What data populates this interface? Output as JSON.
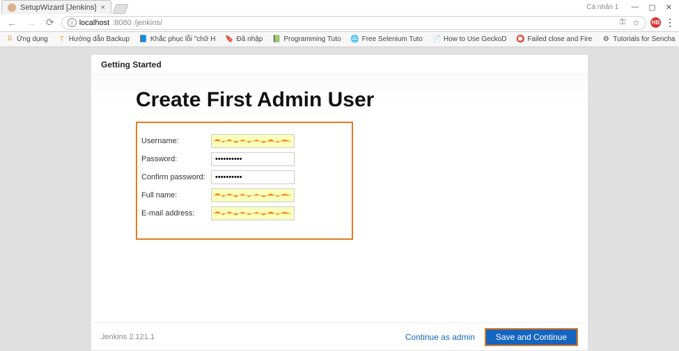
{
  "browser": {
    "tab_title": "SetupWizard [Jenkins]",
    "profile": "Cá nhân 1",
    "url_host": "localhost",
    "url_port": ":8080",
    "url_path": "/jenkins/",
    "nav": {
      "back": "←",
      "fwd": "→",
      "reload": "⟳"
    }
  },
  "bookmarks": {
    "apps": "Ứng dụng",
    "items": [
      {
        "icon": "T",
        "label": "Hướng dẫn Backup"
      },
      {
        "icon": "📘",
        "label": "Khắc phục lỗi \"chữ H"
      },
      {
        "icon": "🔖",
        "label": "Đã nhập"
      },
      {
        "icon": "📗",
        "label": "Programming Tuto"
      },
      {
        "icon": "🌐",
        "label": "Free Selenium Tuto"
      },
      {
        "icon": "📄",
        "label": "How to Use GeckoD"
      },
      {
        "icon": "⭕",
        "label": "Failed close and Fire"
      },
      {
        "icon": "⚙",
        "label": "Tutorials for Sencha"
      }
    ]
  },
  "wizard": {
    "header": "Getting Started",
    "title": "Create First Admin User",
    "fields": {
      "username": {
        "label": "Username:",
        "value": ""
      },
      "password": {
        "label": "Password:",
        "value": "••••••••••"
      },
      "confirm": {
        "label": "Confirm password:",
        "value": "••••••••••"
      },
      "fullname": {
        "label": "Full name:",
        "value": ""
      },
      "email": {
        "label": "E-mail address:",
        "value": ""
      }
    },
    "footer": {
      "version": "Jenkins 2.121.1",
      "continue_admin": "Continue as admin",
      "save": "Save and Continue"
    }
  }
}
